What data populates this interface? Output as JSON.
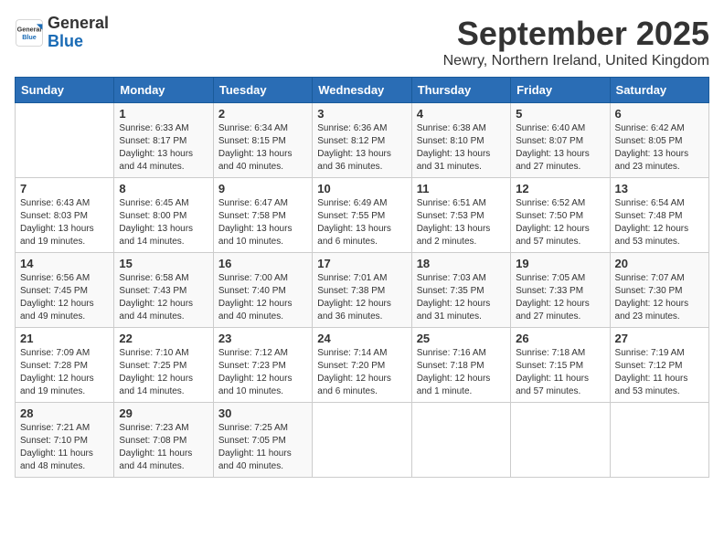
{
  "logo": {
    "general": "General",
    "blue": "Blue"
  },
  "title": "September 2025",
  "location": "Newry, Northern Ireland, United Kingdom",
  "days_of_week": [
    "Sunday",
    "Monday",
    "Tuesday",
    "Wednesday",
    "Thursday",
    "Friday",
    "Saturday"
  ],
  "weeks": [
    [
      {
        "day": "",
        "info": ""
      },
      {
        "day": "1",
        "info": "Sunrise: 6:33 AM\nSunset: 8:17 PM\nDaylight: 13 hours\nand 44 minutes."
      },
      {
        "day": "2",
        "info": "Sunrise: 6:34 AM\nSunset: 8:15 PM\nDaylight: 13 hours\nand 40 minutes."
      },
      {
        "day": "3",
        "info": "Sunrise: 6:36 AM\nSunset: 8:12 PM\nDaylight: 13 hours\nand 36 minutes."
      },
      {
        "day": "4",
        "info": "Sunrise: 6:38 AM\nSunset: 8:10 PM\nDaylight: 13 hours\nand 31 minutes."
      },
      {
        "day": "5",
        "info": "Sunrise: 6:40 AM\nSunset: 8:07 PM\nDaylight: 13 hours\nand 27 minutes."
      },
      {
        "day": "6",
        "info": "Sunrise: 6:42 AM\nSunset: 8:05 PM\nDaylight: 13 hours\nand 23 minutes."
      }
    ],
    [
      {
        "day": "7",
        "info": "Sunrise: 6:43 AM\nSunset: 8:03 PM\nDaylight: 13 hours\nand 19 minutes."
      },
      {
        "day": "8",
        "info": "Sunrise: 6:45 AM\nSunset: 8:00 PM\nDaylight: 13 hours\nand 14 minutes."
      },
      {
        "day": "9",
        "info": "Sunrise: 6:47 AM\nSunset: 7:58 PM\nDaylight: 13 hours\nand 10 minutes."
      },
      {
        "day": "10",
        "info": "Sunrise: 6:49 AM\nSunset: 7:55 PM\nDaylight: 13 hours\nand 6 minutes."
      },
      {
        "day": "11",
        "info": "Sunrise: 6:51 AM\nSunset: 7:53 PM\nDaylight: 13 hours\nand 2 minutes."
      },
      {
        "day": "12",
        "info": "Sunrise: 6:52 AM\nSunset: 7:50 PM\nDaylight: 12 hours\nand 57 minutes."
      },
      {
        "day": "13",
        "info": "Sunrise: 6:54 AM\nSunset: 7:48 PM\nDaylight: 12 hours\nand 53 minutes."
      }
    ],
    [
      {
        "day": "14",
        "info": "Sunrise: 6:56 AM\nSunset: 7:45 PM\nDaylight: 12 hours\nand 49 minutes."
      },
      {
        "day": "15",
        "info": "Sunrise: 6:58 AM\nSunset: 7:43 PM\nDaylight: 12 hours\nand 44 minutes."
      },
      {
        "day": "16",
        "info": "Sunrise: 7:00 AM\nSunset: 7:40 PM\nDaylight: 12 hours\nand 40 minutes."
      },
      {
        "day": "17",
        "info": "Sunrise: 7:01 AM\nSunset: 7:38 PM\nDaylight: 12 hours\nand 36 minutes."
      },
      {
        "day": "18",
        "info": "Sunrise: 7:03 AM\nSunset: 7:35 PM\nDaylight: 12 hours\nand 31 minutes."
      },
      {
        "day": "19",
        "info": "Sunrise: 7:05 AM\nSunset: 7:33 PM\nDaylight: 12 hours\nand 27 minutes."
      },
      {
        "day": "20",
        "info": "Sunrise: 7:07 AM\nSunset: 7:30 PM\nDaylight: 12 hours\nand 23 minutes."
      }
    ],
    [
      {
        "day": "21",
        "info": "Sunrise: 7:09 AM\nSunset: 7:28 PM\nDaylight: 12 hours\nand 19 minutes."
      },
      {
        "day": "22",
        "info": "Sunrise: 7:10 AM\nSunset: 7:25 PM\nDaylight: 12 hours\nand 14 minutes."
      },
      {
        "day": "23",
        "info": "Sunrise: 7:12 AM\nSunset: 7:23 PM\nDaylight: 12 hours\nand 10 minutes."
      },
      {
        "day": "24",
        "info": "Sunrise: 7:14 AM\nSunset: 7:20 PM\nDaylight: 12 hours\nand 6 minutes."
      },
      {
        "day": "25",
        "info": "Sunrise: 7:16 AM\nSunset: 7:18 PM\nDaylight: 12 hours\nand 1 minute."
      },
      {
        "day": "26",
        "info": "Sunrise: 7:18 AM\nSunset: 7:15 PM\nDaylight: 11 hours\nand 57 minutes."
      },
      {
        "day": "27",
        "info": "Sunrise: 7:19 AM\nSunset: 7:12 PM\nDaylight: 11 hours\nand 53 minutes."
      }
    ],
    [
      {
        "day": "28",
        "info": "Sunrise: 7:21 AM\nSunset: 7:10 PM\nDaylight: 11 hours\nand 48 minutes."
      },
      {
        "day": "29",
        "info": "Sunrise: 7:23 AM\nSunset: 7:08 PM\nDaylight: 11 hours\nand 44 minutes."
      },
      {
        "day": "30",
        "info": "Sunrise: 7:25 AM\nSunset: 7:05 PM\nDaylight: 11 hours\nand 40 minutes."
      },
      {
        "day": "",
        "info": ""
      },
      {
        "day": "",
        "info": ""
      },
      {
        "day": "",
        "info": ""
      },
      {
        "day": "",
        "info": ""
      }
    ]
  ]
}
